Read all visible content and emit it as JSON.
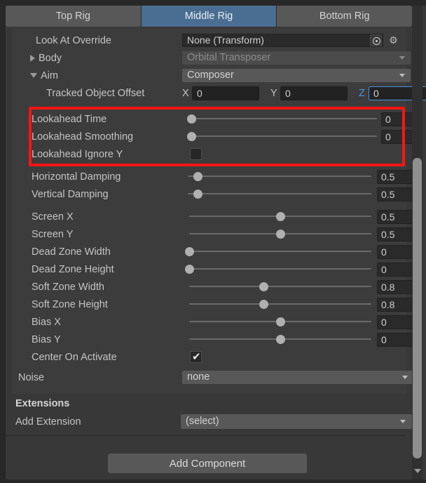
{
  "tabs": [
    {
      "label": "Top Rig",
      "active": false
    },
    {
      "label": "Middle Rig",
      "active": true
    },
    {
      "label": "Bottom Rig",
      "active": false
    }
  ],
  "look_at_override": {
    "label": "Look At Override",
    "value": "None (Transform)",
    "picker_icon": "object-picker-icon",
    "gear_icon": "gear-icon"
  },
  "body": {
    "label": "Body",
    "value": "Orbital Transposer",
    "expanded": false,
    "disabled": true
  },
  "aim": {
    "label": "Aim",
    "value": "Composer",
    "expanded": true
  },
  "tracked_object_offset": {
    "label": "Tracked Object Offset",
    "x_axis": "X",
    "x_value": "0",
    "y_axis": "Y",
    "y_value": "0",
    "z_axis": "Z",
    "z_value": "0",
    "focused_axis": "Z"
  },
  "highlight_color": "#f91414",
  "lookahead": [
    {
      "label": "Lookahead Time",
      "value": "0",
      "fraction": 0.0,
      "type": "slider"
    },
    {
      "label": "Lookahead Smoothing",
      "value": "0",
      "fraction": 0.0,
      "type": "slider"
    },
    {
      "label": "Lookahead Ignore Y",
      "checked": false,
      "type": "checkbox"
    }
  ],
  "damping": [
    {
      "label": "Horizontal Damping",
      "value": "0.5",
      "fraction": 0.055
    },
    {
      "label": "Vertical Damping",
      "value": "0.5",
      "fraction": 0.055
    }
  ],
  "composer_settings": [
    {
      "label": "Screen X",
      "value": "0.5",
      "fraction": 0.5
    },
    {
      "label": "Screen Y",
      "value": "0.5",
      "fraction": 0.5
    },
    {
      "label": "Dead Zone Width",
      "value": "0",
      "fraction": 0.0
    },
    {
      "label": "Dead Zone Height",
      "value": "0",
      "fraction": 0.0
    },
    {
      "label": "Soft Zone Width",
      "value": "0.8",
      "fraction": 0.41
    },
    {
      "label": "Soft Zone Height",
      "value": "0.8",
      "fraction": 0.41
    },
    {
      "label": "Bias X",
      "value": "0",
      "fraction": 0.5
    },
    {
      "label": "Bias Y",
      "value": "0",
      "fraction": 0.5
    }
  ],
  "center_on_activate": {
    "label": "Center On Activate",
    "checked": true,
    "mark": "✔"
  },
  "noise": {
    "label": "Noise",
    "value": "none"
  },
  "extensions": {
    "title": "Extensions",
    "add_label": "Add Extension",
    "add_value": "(select)"
  },
  "add_component": {
    "label": "Add Component"
  },
  "scrollbar": {
    "down_arrow_icon": "chevron-down-icon"
  }
}
